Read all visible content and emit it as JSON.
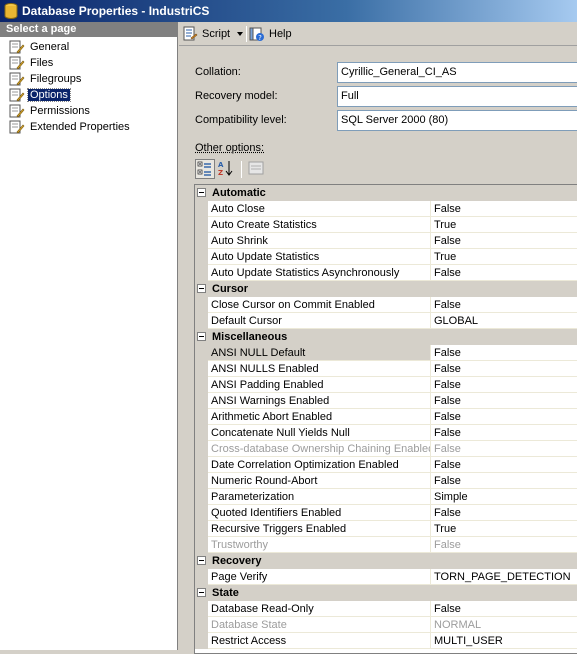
{
  "window": {
    "title": "Database Properties - IndustriCS"
  },
  "left_pane": {
    "header": "Select a page",
    "items": [
      {
        "label": "General"
      },
      {
        "label": "Files"
      },
      {
        "label": "Filegroups"
      },
      {
        "label": "Options",
        "selected": true
      },
      {
        "label": "Permissions"
      },
      {
        "label": "Extended Properties"
      }
    ]
  },
  "toolbar": {
    "script_label": "Script",
    "help_label": "Help"
  },
  "fields": {
    "collation_label": "Collation:",
    "collation_value": "Cyrillic_General_CI_AS",
    "recovery_label": "Recovery model:",
    "recovery_value": "Full",
    "compat_label": "Compatibility level:",
    "compat_value": "SQL Server 2000 (80)"
  },
  "other_options_label": "Other options:",
  "grid": {
    "categories": [
      {
        "name": "Automatic",
        "props": [
          [
            "Auto Close",
            "False"
          ],
          [
            "Auto Create Statistics",
            "True"
          ],
          [
            "Auto Shrink",
            "False"
          ],
          [
            "Auto Update Statistics",
            "True"
          ],
          [
            "Auto Update Statistics Asynchronously",
            "False"
          ]
        ]
      },
      {
        "name": "Cursor",
        "props": [
          [
            "Close Cursor on Commit Enabled",
            "False"
          ],
          [
            "Default Cursor",
            "GLOBAL"
          ]
        ]
      },
      {
        "name": "Miscellaneous",
        "props": [
          [
            "ANSI NULL Default",
            "False"
          ],
          [
            "ANSI NULLS Enabled",
            "False"
          ],
          [
            "ANSI Padding Enabled",
            "False"
          ],
          [
            "ANSI Warnings Enabled",
            "False"
          ],
          [
            "Arithmetic Abort Enabled",
            "False"
          ],
          [
            "Concatenate Null Yields Null",
            "False"
          ],
          [
            "Cross-database Ownership Chaining Enabled",
            "False"
          ],
          [
            "Date Correlation Optimization Enabled",
            "False"
          ],
          [
            "Numeric Round-Abort",
            "False"
          ],
          [
            "Parameterization",
            "Simple"
          ],
          [
            "Quoted Identifiers Enabled",
            "False"
          ],
          [
            "Recursive Triggers Enabled",
            "True"
          ],
          [
            "Trustworthy",
            "False"
          ]
        ]
      },
      {
        "name": "Recovery",
        "props": [
          [
            "Page Verify",
            "TORN_PAGE_DETECTION"
          ]
        ]
      },
      {
        "name": "State",
        "props": [
          [
            "Database Read-Only",
            "False"
          ],
          [
            "Database State",
            "NORMAL"
          ],
          [
            "Restrict Access",
            "MULTI_USER"
          ]
        ]
      }
    ],
    "selected_prop": "ANSI NULL Default",
    "disabled_props": [
      "Cross-database Ownership Chaining Enabled",
      "Trustworthy",
      "Database State"
    ]
  },
  "colors": {
    "title_bar": "#0a246a",
    "selection": "#0a246a",
    "panel": "#d4d0c8"
  },
  "icons": {
    "app": "database-icon",
    "page": "page-wrench-icon",
    "script": "script-icon",
    "help": "help-icon",
    "categorized": "categorized-icon",
    "alphabetical": "alphabetical-icon",
    "property_pages": "property-pages-icon"
  }
}
